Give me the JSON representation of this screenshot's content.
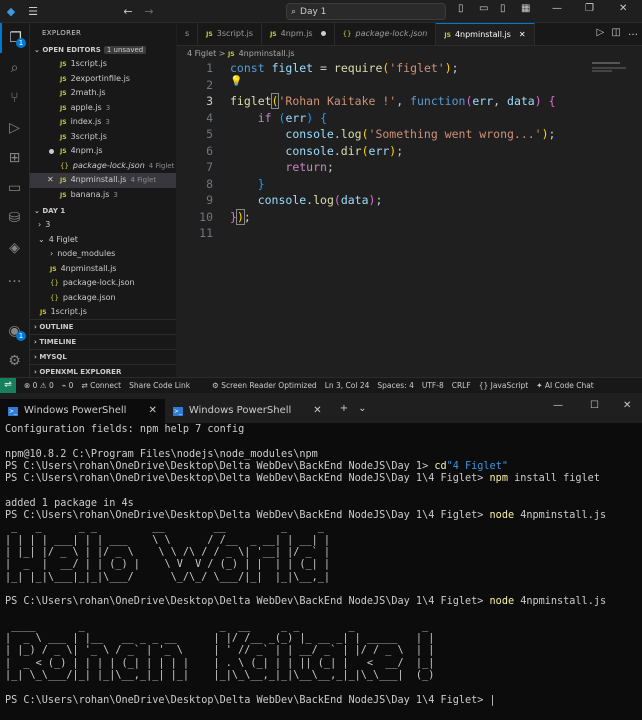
{
  "window": {
    "search_text": "Day 1"
  },
  "sidebar": {
    "title": "EXPLORER",
    "open_editors": {
      "label": "OPEN EDITORS",
      "badge": "1 unsaved"
    },
    "open_files": [
      {
        "name": "1script.js",
        "sub": ""
      },
      {
        "name": "2exportinfile.js",
        "sub": ""
      },
      {
        "name": "2math.js",
        "sub": ""
      },
      {
        "name": "apple.js",
        "sub": "3"
      },
      {
        "name": "index.js",
        "sub": "3"
      },
      {
        "name": "3script.js",
        "sub": ""
      },
      {
        "name": "4npm.js",
        "sub": ""
      },
      {
        "name": "package-lock.json",
        "sub": "4 Figlet"
      },
      {
        "name": "4npminstall.js",
        "sub": "4 Figlet"
      },
      {
        "name": "banana.js",
        "sub": "3"
      }
    ],
    "day_section": "DAY 1",
    "tree": [
      {
        "name": "3"
      },
      {
        "name": "4 Figlet"
      },
      {
        "name": "node_modules"
      },
      {
        "name": "4npminstall.js"
      },
      {
        "name": "package-lock.json"
      },
      {
        "name": "package.json"
      },
      {
        "name": "1script.js"
      }
    ],
    "bottom_sections": [
      "OUTLINE",
      "TIMELINE",
      "MYSQL",
      "OPENXML EXPLORER"
    ]
  },
  "tabs": [
    {
      "label": "s"
    },
    {
      "label": "3script.js"
    },
    {
      "label": "4npm.js"
    },
    {
      "label": "package-lock.json"
    },
    {
      "label": "4npminstall.js"
    }
  ],
  "breadcrumb": [
    "4 Figlet",
    "4npminstall.js"
  ],
  "code": {
    "line_numbers": [
      "1",
      "2",
      "3",
      "4",
      "5",
      "6",
      "7",
      "8",
      "9",
      "10",
      "11"
    ],
    "l1": {
      "kw": "const",
      "var": "figlet",
      "eq": "=",
      "fn": "require",
      "str": "'figlet'"
    },
    "l3": {
      "fn": "figlet",
      "str": "'Rohan Kaitake !'",
      "kw": "function",
      "p1": "err",
      "p2": "data"
    },
    "l4": {
      "kw": "if",
      "var": "err"
    },
    "l5": {
      "obj": "console",
      "fn": "log",
      "str": "'Something went wrong...'"
    },
    "l6": {
      "obj": "console",
      "fn": "dir",
      "var": "err"
    },
    "l7": {
      "kw": "return"
    },
    "l9": {
      "obj": "console",
      "fn": "log",
      "var": "data"
    }
  },
  "statusbar": {
    "errors": "0",
    "warnings": "0",
    "ports": "0",
    "connect": "Connect",
    "share": "Share Code Link",
    "screen_reader": "Screen Reader Optimized",
    "position": "Ln 3, Col 24",
    "spaces": "Spaces: 4",
    "encoding": "UTF-8",
    "eol": "CRLF",
    "language": "JavaScript",
    "ai": "AI Code Chat"
  },
  "terminal": {
    "tab1": "Windows PowerShell",
    "tab2": "Windows PowerShell",
    "lines": [
      {
        "t": "Configuration fields: npm help 7 config",
        "c": ""
      },
      {
        "t": "",
        "c": ""
      },
      {
        "t": "npm@10.8.2 C:\\Program Files\\nodejs\\node_modules\\npm",
        "c": ""
      },
      {
        "t": "PS C:\\Users\\rohan\\OneDrive\\Desktop\\Delta WebDev\\BackEnd NodeJS\\Day 1> ",
        "c": "cd",
        "s": "\"4 Figlet\""
      },
      {
        "t": "PS C:\\Users\\rohan\\OneDrive\\Desktop\\Delta WebDev\\BackEnd NodeJS\\Day 1\\4 Figlet> ",
        "c": "npm",
        "s": " install figlet"
      },
      {
        "t": "",
        "c": ""
      },
      {
        "t": "added 1 package in 4s",
        "c": ""
      },
      {
        "t": "PS C:\\Users\\rohan\\OneDrive\\Desktop\\Delta WebDev\\BackEnd NodeJS\\Day 1\\4 Figlet> ",
        "c": "node",
        "s": " 4npminstall.js"
      }
    ],
    "art1": [
      " _   _      _ _         __        __         _     _ ",
      "| | | | ___| | | ___    \\ \\      / /__  _ __| | __| |",
      "| |_| |/ _ \\ | |/ _ \\    \\ \\ /\\ / / _ \\| '__| |/ _` |",
      "|  _  |  __/ | | (_) |    \\ V  V / (_) | |  | | (_| |",
      "|_| |_|\\___|_|_|\\___/      \\_/\\_/ \\___/|_|  |_|\\__,_|"
    ],
    "prompt2": "PS C:\\Users\\rohan\\OneDrive\\Desktop\\Delta WebDev\\BackEnd NodeJS\\Day 1\\4 Figlet> ",
    "cmd2": "node",
    "arg2": " 4npminstall.js",
    "art2": [
      " ____       _                      _  __     _ _        _           _ ",
      "|  _ \\ ___ | |__   __ _ _ __      | |/ /__ _(_) |_ __ _| | _____   | |",
      "| |_) / _ \\| '_ \\ / _` | '_ \\     | ' // _` | | __/ _` | |/ / _ \\  | |",
      "|  _ < (_) | | | | (_| | | | |    | . \\ (_| | | || (_| |   <  __/  |_|",
      "|_| \\_\\___/|_| |_|\\__,_|_| |_|    |_|\\_\\__,_|_|\\__\\__,_|_|\\_\\___|  (_)"
    ],
    "final_prompt": "PS C:\\Users\\rohan\\OneDrive\\Desktop\\Delta WebDev\\BackEnd NodeJS\\Day 1\\4 Figlet> "
  }
}
